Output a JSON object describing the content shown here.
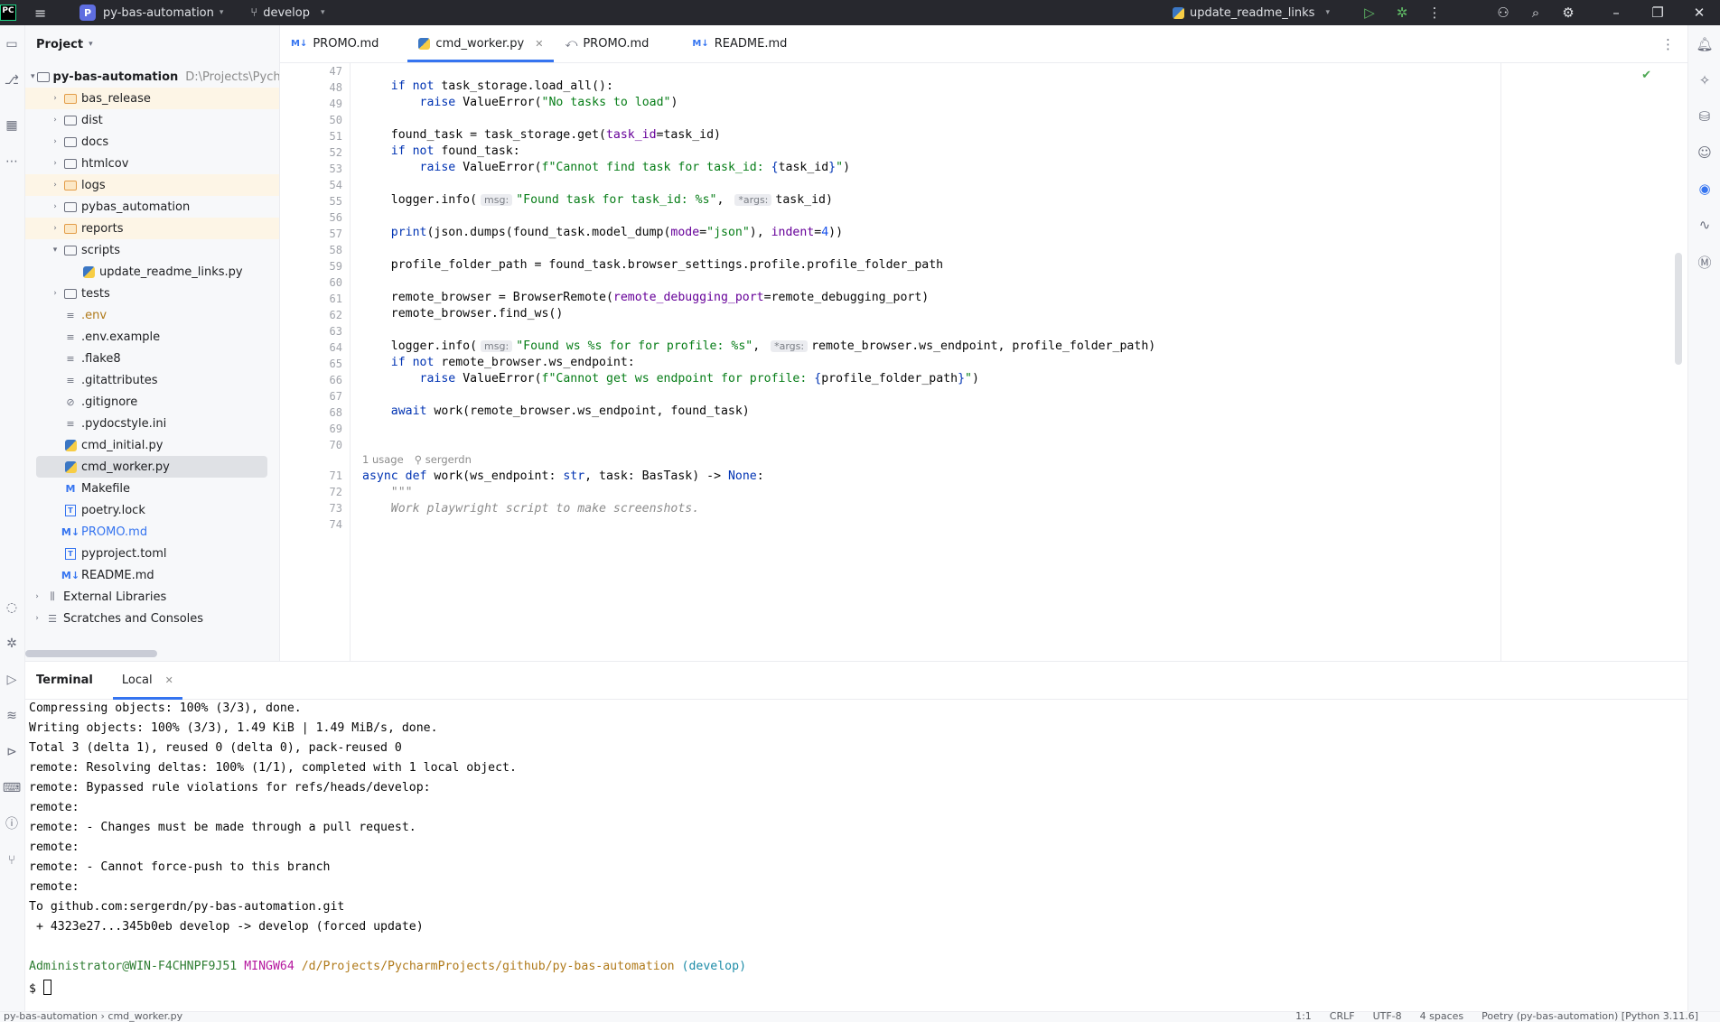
{
  "titlebar": {
    "logo": "PC",
    "project_badge": "P",
    "project_name": "py-bas-automation",
    "branch": "develop",
    "run_config": "update_readme_links"
  },
  "project_panel": {
    "title": "Project",
    "root": {
      "name": "py-bas-automation",
      "path": "D:\\Projects\\Pych"
    },
    "items": [
      {
        "name": "bas_release"
      },
      {
        "name": "dist"
      },
      {
        "name": "docs"
      },
      {
        "name": "htmlcov"
      },
      {
        "name": "logs"
      },
      {
        "name": "pybas_automation"
      },
      {
        "name": "reports"
      },
      {
        "name": "scripts"
      },
      {
        "name": "update_readme_links.py"
      },
      {
        "name": "tests"
      },
      {
        "name": ".env"
      },
      {
        "name": ".env.example"
      },
      {
        "name": ".flake8"
      },
      {
        "name": ".gitattributes"
      },
      {
        "name": ".gitignore"
      },
      {
        "name": ".pydocstyle.ini"
      },
      {
        "name": "cmd_initial.py"
      },
      {
        "name": "cmd_worker.py"
      },
      {
        "name": "Makefile"
      },
      {
        "name": "poetry.lock"
      },
      {
        "name": "PROMO.md"
      },
      {
        "name": "pyproject.toml"
      },
      {
        "name": "README.md"
      },
      {
        "name": "External Libraries"
      },
      {
        "name": "Scratches and Consoles"
      }
    ]
  },
  "editor": {
    "tabs": [
      {
        "label": "PROMO.md"
      },
      {
        "label": "cmd_worker.py"
      },
      {
        "label": "PROMO.md"
      },
      {
        "label": "README.md"
      }
    ],
    "line_numbers": [
      "47",
      "48",
      "49",
      "50",
      "51",
      "52",
      "53",
      "54",
      "55",
      "56",
      "57",
      "58",
      "59",
      "60",
      "61",
      "62",
      "63",
      "64",
      "65",
      "66",
      "67",
      "68",
      "69",
      "70",
      "71",
      "72",
      "73",
      "74"
    ],
    "inlay": {
      "usages": "1 usage",
      "author": "sergerdn"
    },
    "hints": {
      "msg": "msg:",
      "args": "*args:"
    }
  },
  "terminal": {
    "title": "Terminal",
    "tab": "Local",
    "lines": [
      "Compressing objects: 100% (3/3), done.",
      "Writing objects: 100% (3/3), 1.49 KiB | 1.49 MiB/s, done.",
      "Total 3 (delta 1), reused 0 (delta 0), pack-reused 0",
      "remote: Resolving deltas: 100% (1/1), completed with 1 local object.",
      "remote: Bypassed rule violations for refs/heads/develop:",
      "remote:",
      "remote: - Changes must be made through a pull request.",
      "remote:",
      "remote: - Cannot force-push to this branch",
      "remote:",
      "To github.com:sergerdn/py-bas-automation.git",
      " + 4323e27...345b0eb develop -> develop (forced update)"
    ],
    "prompt": {
      "user": "Administrator@WIN-F4CHNPF9J51",
      "shell": "MINGW64",
      "path": "/d/Projects/PycharmProjects/github/py-bas-automation",
      "branch": "(develop)",
      "symbol": "$"
    }
  },
  "statusbar": {
    "breadcrumb_project": "py-bas-automation",
    "breadcrumb_file": "cmd_worker.py",
    "position": "1:1",
    "line_sep": "CRLF",
    "encoding": "UTF-8",
    "indent": "4 spaces",
    "interpreter": "Poetry (py-bas-automation) [Python 3.11.6]"
  }
}
